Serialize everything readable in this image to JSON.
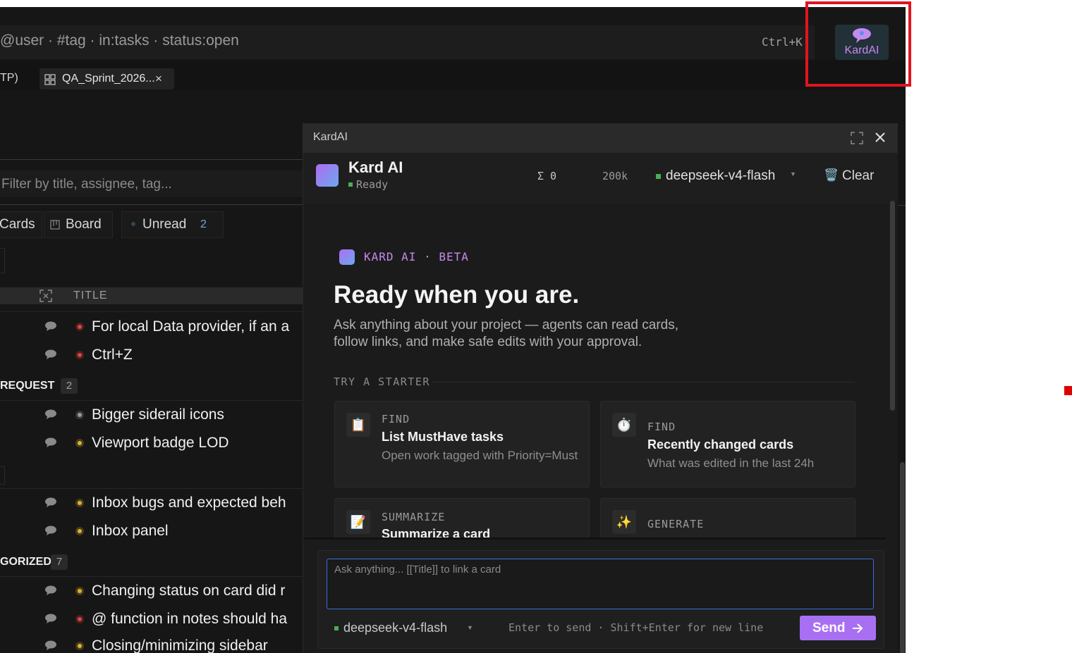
{
  "topbar": {
    "search_text": "@user · #tag · in:tasks · status:open",
    "shortcut": "Ctrl+K",
    "kardai_label": "KardAI"
  },
  "tabs": {
    "prev_tab": "TP)",
    "active_tab": "QA_Sprint_2026...",
    "close_glyph": "×"
  },
  "left": {
    "filter_placeholder": "Filter by title, assignee, tag...",
    "views": [
      {
        "label": "Cards",
        "icon": "cards-icon"
      },
      {
        "label": "Board",
        "icon": "board-icon"
      },
      {
        "label": "Unread",
        "count": "2",
        "icon": "unread-dot-icon"
      }
    ],
    "column_title": "TITLE",
    "rows": [
      {
        "text": "For local Data provider, if an a",
        "status_color": "#e0453a"
      },
      {
        "text": "Ctrl+Z",
        "status_color": "#e0453a"
      },
      {
        "group": "REQUEST",
        "count": "2"
      },
      {
        "text": "Bigger siderail icons",
        "status_color": "#9a9a9a"
      },
      {
        "text": "Viewport badge LOD",
        "status_color": "#e0b030"
      },
      {
        "text": "Inbox bugs and expected beh",
        "status_color": "#e0b030"
      },
      {
        "text": "Inbox panel",
        "status_color": "#e0b030"
      },
      {
        "group": "GORIZED",
        "count": "7"
      },
      {
        "text": "Changing status on card did r",
        "status_color": "#e0b030"
      },
      {
        "text": "@ function in notes should ha",
        "status_color": "#e0453a"
      },
      {
        "text": "Closing/minimizing sidebar",
        "status_color": "#e0b030"
      }
    ]
  },
  "chat": {
    "window_title": "KardAI",
    "agent_name": "Kard AI",
    "status": "Ready",
    "token_sigma": "Σ 0",
    "context": "200k",
    "model": "deepseek-v4-flash",
    "clear_label": "Clear",
    "badge": "KARD AI · BETA",
    "headline": "Ready when you are.",
    "intro_line1": "Ask anything about your project — agents can read cards,",
    "intro_line2": "follow links, and make safe edits with your approval.",
    "starter_heading": "TRY A STARTER",
    "starters": [
      {
        "kind": "FIND",
        "title": "List MustHave tasks",
        "desc": "Open work tagged with Priority=Must",
        "icon": "📋"
      },
      {
        "kind": "FIND",
        "title": "Recently changed cards",
        "desc": "What was edited in the last 24h",
        "icon": "⏱️"
      },
      {
        "kind": "SUMMARIZE",
        "title": "Summarize a card",
        "desc": "",
        "icon": "📝"
      },
      {
        "kind": "GENERATE",
        "title": "",
        "desc": "",
        "icon": "✨"
      }
    ],
    "input_placeholder": "Ask anything...   [[Title]] to link a card",
    "footer_model": "deepseek-v4-flash",
    "hint": "Enter to send · Shift+Enter for new line",
    "send_label": "Send"
  },
  "colors": {
    "accent": "#a96ff2",
    "ready_green": "#4caf50",
    "highlight_red": "#e0141e"
  }
}
